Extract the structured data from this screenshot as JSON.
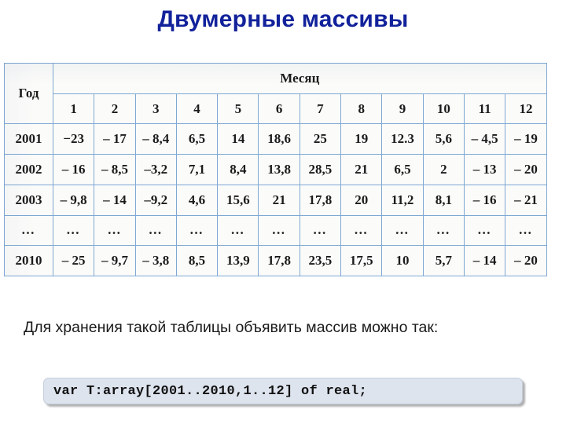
{
  "slide": {
    "title": "Двумерные массивы",
    "title_color": "#12229b",
    "body_paragraph": "Для хранения такой таблицы объявить массив можно так:",
    "code": "var T:array[2001..2010,1..12] of real;",
    "code_bg": "#dde4ee",
    "table_border_color": "#7fa8d4",
    "paper_color": "#fbfbf9"
  },
  "table": {
    "corner_label": "Год",
    "group_header": "Месяц",
    "month_columns": [
      "1",
      "2",
      "3",
      "4",
      "5",
      "6",
      "7",
      "8",
      "9",
      "10",
      "11",
      "12"
    ],
    "rows": [
      {
        "year": "2001",
        "values": [
          "−23",
          "– 17",
          "– 8,4",
          "6,5",
          "14",
          "18,6",
          "25",
          "19",
          "12.3",
          "5,6",
          "– 4,5",
          "– 19"
        ]
      },
      {
        "year": "2002",
        "values": [
          "– 16",
          "– 8,5",
          "–3,2",
          "7,1",
          "8,4",
          "13,8",
          "28,5",
          "21",
          "6,5",
          "2",
          "– 13",
          "– 20"
        ]
      },
      {
        "year": "2003",
        "values": [
          "– 9,8",
          "– 14",
          "–9,2",
          "4,6",
          "15,6",
          "21",
          "17,8",
          "20",
          "11,2",
          "8,1",
          "– 16",
          "– 21"
        ]
      },
      {
        "year": "…",
        "values": [
          "…",
          "…",
          "…",
          "…",
          "…",
          "…",
          "…",
          "…",
          "…",
          "…",
          "…",
          "…"
        ]
      },
      {
        "year": "2010",
        "values": [
          "– 25",
          "– 9,7",
          "– 3,8",
          "8,5",
          "13,9",
          "17,8",
          "23,5",
          "17,5",
          "10",
          "5,7",
          "– 14",
          "– 20"
        ]
      }
    ]
  }
}
